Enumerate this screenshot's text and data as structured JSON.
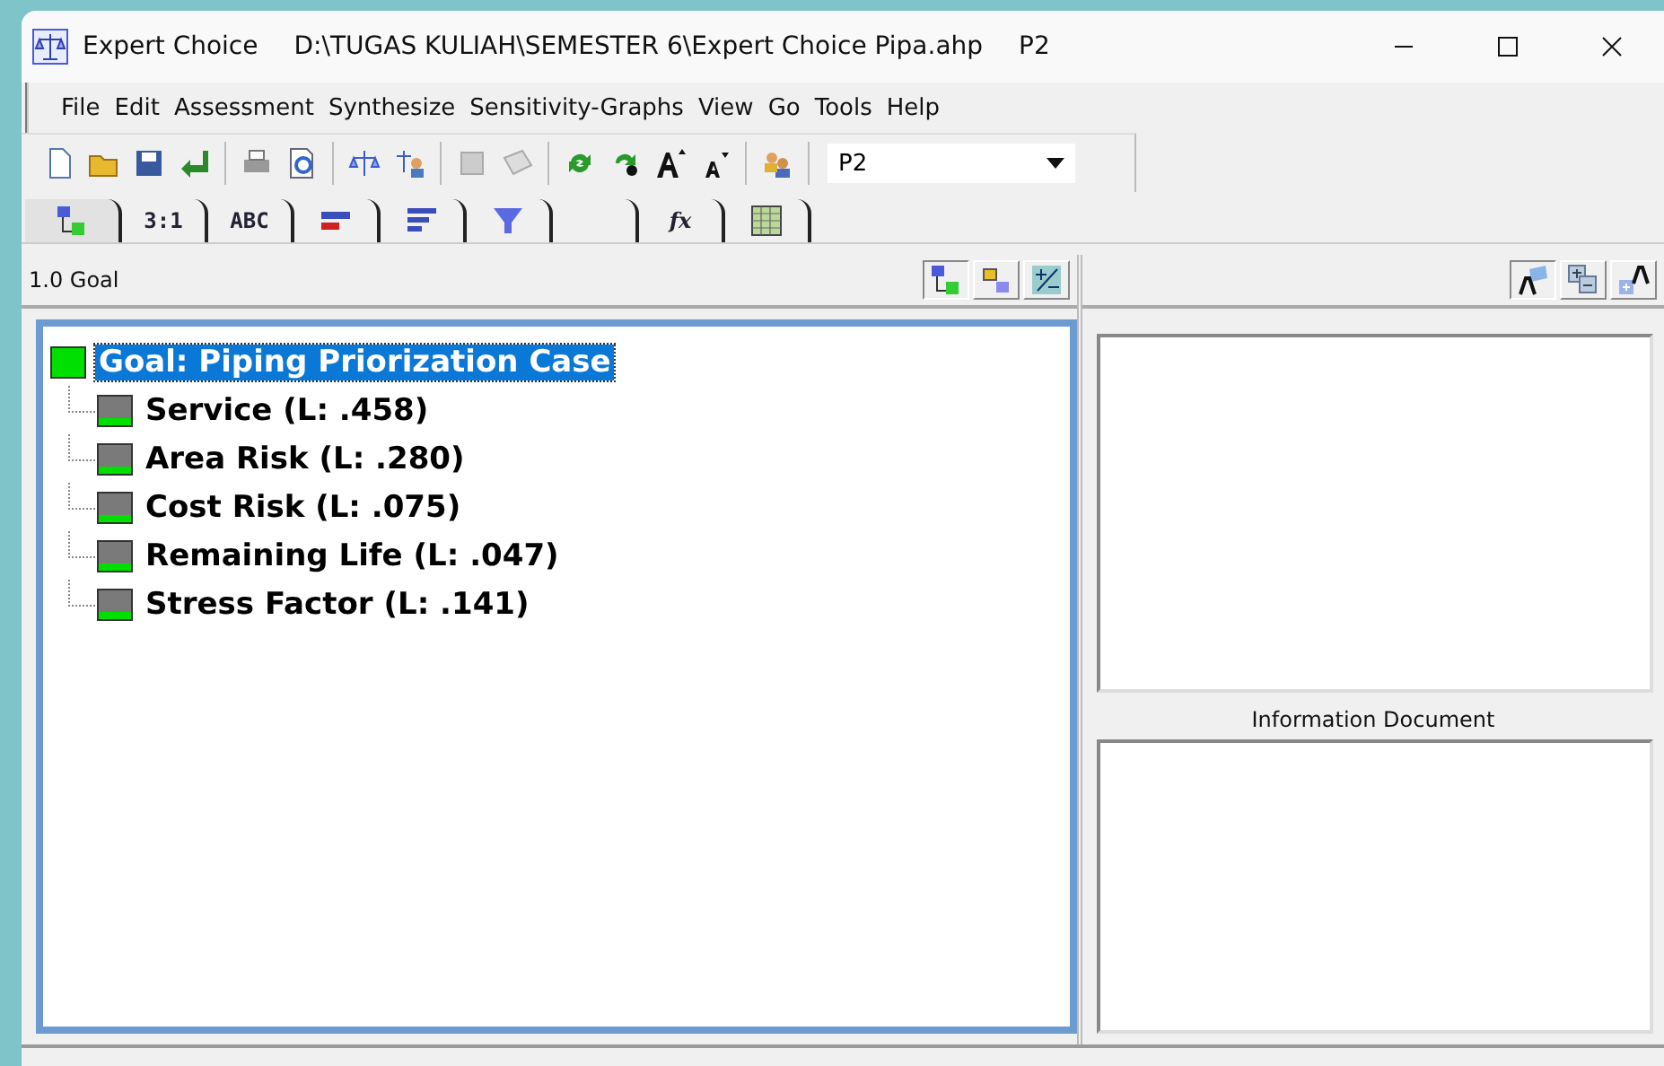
{
  "window": {
    "app": "Expert Choice",
    "path": "D:\\TUGAS KULIAH\\SEMESTER 6\\Expert Choice Pipa.ahp",
    "model": "P2"
  },
  "menu": [
    "File",
    "Edit",
    "Assessment",
    "Synthesize",
    "Sensitivity-Graphs",
    "View",
    "Go",
    "Tools",
    "Help"
  ],
  "toolbar": {
    "combo_value": "P2"
  },
  "tabs": [
    {
      "kind": "tree",
      "selected": true
    },
    {
      "kind": "text",
      "label": "3:1",
      "selected": false
    },
    {
      "kind": "text",
      "label": "ABC",
      "selected": false
    },
    {
      "kind": "bars2",
      "selected": false
    },
    {
      "kind": "bars3",
      "selected": false
    },
    {
      "kind": "funnel",
      "selected": false
    },
    {
      "kind": "blank",
      "selected": false
    },
    {
      "kind": "formula",
      "label": "fx",
      "selected": false
    },
    {
      "kind": "grid",
      "selected": false
    }
  ],
  "tree_header": "1.0 Goal",
  "tree": {
    "label": "Goal: Piping Priorization Case",
    "selected": true,
    "children": [
      {
        "label": "Service (L: .458)",
        "selected": false
      },
      {
        "label": "Area Risk (L: .280)",
        "selected": false
      },
      {
        "label": "Cost Risk (L: .075)",
        "selected": false
      },
      {
        "label": "Remaining Life (L: .047)",
        "selected": false
      },
      {
        "label": "Stress Factor (L: .141)",
        "selected": false
      }
    ]
  },
  "info_document_label": "Information Document"
}
